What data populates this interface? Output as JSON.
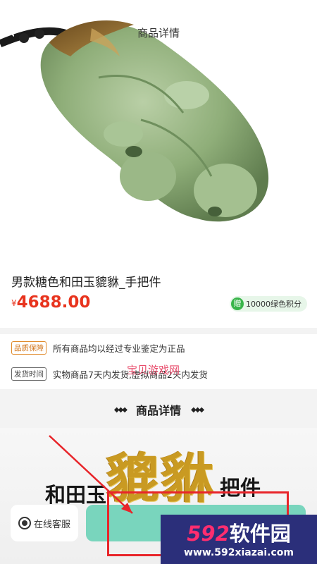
{
  "header": {
    "title": "商品详情",
    "back_icon": "chevron-left-icon"
  },
  "product": {
    "title": "男款糖色和田玉貔貅_手把件",
    "currency_symbol": "¥",
    "price": "4688.00",
    "points_badge_char": "赠",
    "points": "10000绿色积分"
  },
  "guarantees": [
    {
      "tag": "品质保障",
      "text": "所有商品均以经过专业鉴定为正品"
    },
    {
      "tag": "发货时间",
      "text": "实物商品7天内发货,虚拟商品2天内发货"
    }
  ],
  "watermark_text": "宝贝游戏网",
  "detail_section": {
    "title": "商品详情"
  },
  "poster": {
    "left": "和田玉",
    "big": "貔貅",
    "right": "把件"
  },
  "bottom_bar": {
    "service_label": "在线客服",
    "service_icon": "headset-icon"
  },
  "overlay_logo": {
    "brand_num": "592",
    "brand_text": "软件园",
    "url": "www.592xiazai.com"
  },
  "colors": {
    "price": "#e8341e",
    "buy_button": "#79d5bd",
    "points_green": "#39b54a",
    "annotation": "#e8252a"
  }
}
